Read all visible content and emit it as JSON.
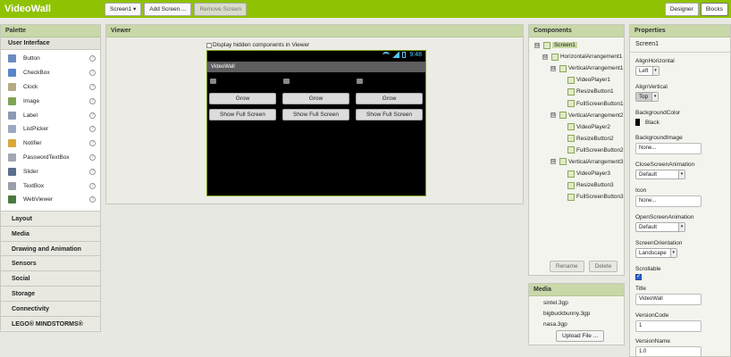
{
  "app": {
    "title": "VideoWall"
  },
  "toolbar": {
    "screen_select": "Screen1 ▾",
    "add_screen": "Add Screen ...",
    "remove_screen": "Remove Screen",
    "designer": "Designer",
    "blocks": "Blocks"
  },
  "palette": {
    "title": "Palette",
    "section": "User Interface",
    "items": [
      {
        "label": "Button",
        "icon": "button-icon",
        "color": "#6c8bc0"
      },
      {
        "label": "CheckBox",
        "icon": "checkbox-icon",
        "color": "#5a86c9"
      },
      {
        "label": "Clock",
        "icon": "clock-icon",
        "color": "#b7aa82"
      },
      {
        "label": "Image",
        "icon": "image-icon",
        "color": "#7fa352"
      },
      {
        "label": "Label",
        "icon": "label-icon",
        "color": "#8a9bb3"
      },
      {
        "label": "ListPicker",
        "icon": "listpicker-icon",
        "color": "#9aa9c0"
      },
      {
        "label": "Notifier",
        "icon": "notifier-icon",
        "color": "#d9a93a"
      },
      {
        "label": "PasswordTextBox",
        "icon": "password-textbox-icon",
        "color": "#a0a8b5"
      },
      {
        "label": "Slider",
        "icon": "slider-icon",
        "color": "#5b6e8e"
      },
      {
        "label": "TextBox",
        "icon": "textbox-icon",
        "color": "#9aa0aa"
      },
      {
        "label": "WebViewer",
        "icon": "webviewer-icon",
        "color": "#4a7a3f"
      }
    ],
    "help_glyph": "?",
    "categories": [
      "Layout",
      "Media",
      "Drawing and Animation",
      "Sensors",
      "Social",
      "Storage",
      "Connectivity",
      "LEGO® MINDSTORMS®"
    ]
  },
  "viewer": {
    "title": "Viewer",
    "hidden_components_label": "Display hidden components in Viewer",
    "time": "9:48",
    "screen_title": "VideoWall",
    "columns": [
      {
        "grow": "Grow",
        "fullscreen": "Show Full Screen"
      },
      {
        "grow": "Grow",
        "fullscreen": "Show Full Screen"
      },
      {
        "grow": "Grow",
        "fullscreen": "Show Full Screen"
      }
    ]
  },
  "components": {
    "title": "Components",
    "tree": [
      {
        "label": "Screen1",
        "level": 0,
        "toggle": "⊟",
        "selected": true
      },
      {
        "label": "HorizontalArrangement1",
        "level": 1,
        "toggle": "⊟"
      },
      {
        "label": "VerticalArrangement1",
        "level": 2,
        "toggle": "⊟"
      },
      {
        "label": "VideoPlayer1",
        "level": 3
      },
      {
        "label": "ResizeButton1",
        "level": 3
      },
      {
        "label": "FullScreenButton1",
        "level": 3
      },
      {
        "label": "VerticalArrangement2",
        "level": 2,
        "toggle": "⊟"
      },
      {
        "label": "VideoPlayer2",
        "level": 3
      },
      {
        "label": "ResizeButton2",
        "level": 3
      },
      {
        "label": "FullScreenButton2",
        "level": 3
      },
      {
        "label": "VerticalArrangement3",
        "level": 2,
        "toggle": "⊟"
      },
      {
        "label": "VideoPlayer3",
        "level": 3
      },
      {
        "label": "ResizeButton3",
        "level": 3
      },
      {
        "label": "FullScreenButton3",
        "level": 3
      }
    ],
    "rename": "Rename",
    "delete": "Delete"
  },
  "media": {
    "title": "Media",
    "files": [
      "sintel.3gp",
      "bigbuckbunny.3gp",
      "nasa.3gp"
    ],
    "upload": "Upload File ..."
  },
  "properties": {
    "title": "Properties",
    "component": "Screen1",
    "align_horizontal_label": "AlignHorizontal",
    "align_horizontal_value": "Left",
    "align_vertical_label": "AlignVertical",
    "align_vertical_value": "Top",
    "background_color_label": "BackgroundColor",
    "background_color_value": "Black",
    "background_image_label": "BackgroundImage",
    "background_image_value": "None...",
    "close_anim_label": "CloseScreenAnimation",
    "close_anim_value": "Default",
    "icon_label": "Icon",
    "icon_value": "None...",
    "open_anim_label": "OpenScreenAnimation",
    "open_anim_value": "Default",
    "orientation_label": "ScreenOrientation",
    "orientation_value": "Landscape",
    "scrollable_label": "Scrollable",
    "title_label": "Title",
    "title_value": "VideoWall",
    "version_code_label": "VersionCode",
    "version_code_value": "1",
    "version_name_label": "VersionName",
    "version_name_value": "1.0",
    "dropdown_arrow": "▾",
    "check_glyph": "✓"
  }
}
